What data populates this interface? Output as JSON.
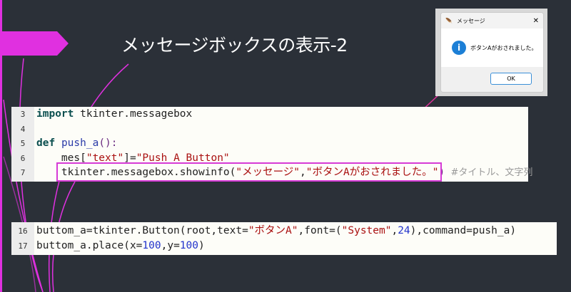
{
  "slide": {
    "title": "メッセージボックスの表示-2"
  },
  "colors": {
    "accent": "#e030e0",
    "background": "#2b3038"
  },
  "dialog": {
    "title": "メッセージ",
    "message": "ボタンAがおされました。",
    "ok_label": "OK",
    "icon": "info-icon",
    "close": "✕",
    "app_icon": "feather-icon"
  },
  "code_block_1": [
    {
      "num": "3",
      "tokens": [
        {
          "t": "import",
          "c": "kw"
        },
        {
          "t": " tkinter.messagebox",
          "c": ""
        }
      ]
    },
    {
      "num": "4",
      "tokens": []
    },
    {
      "num": "5",
      "tokens": [
        {
          "t": "def",
          "c": "kw"
        },
        {
          "t": " ",
          "c": ""
        },
        {
          "t": "push_a",
          "c": "fn"
        },
        {
          "t": "():",
          "c": "par"
        }
      ]
    },
    {
      "num": "6",
      "tokens": [
        {
          "t": "    mes[",
          "c": ""
        },
        {
          "t": "\"text\"",
          "c": "str"
        },
        {
          "t": "]=",
          "c": ""
        },
        {
          "t": "\"Push A Button\"",
          "c": "str"
        }
      ]
    },
    {
      "num": "7",
      "tokens": [
        {
          "t": "    tkinter.messagebox.showinfo(",
          "c": ""
        },
        {
          "t": "\"メッセージ\"",
          "c": "str"
        },
        {
          "t": ",",
          "c": ""
        },
        {
          "t": "\"ボタンAがおされました。\"",
          "c": "str"
        },
        {
          "t": ")",
          "c": "par"
        },
        {
          "t": "  #タイトル、文字列",
          "c": "cm"
        }
      ]
    }
  ],
  "code_block_2": [
    {
      "num": "16",
      "tokens": [
        {
          "t": "buttom_a=tkinter.Button(root,text=",
          "c": ""
        },
        {
          "t": "\"ボタンA\"",
          "c": "str"
        },
        {
          "t": ",font=(",
          "c": ""
        },
        {
          "t": "\"System\"",
          "c": "str"
        },
        {
          "t": ",",
          "c": ""
        },
        {
          "t": "24",
          "c": "numv"
        },
        {
          "t": "),command=push_a)",
          "c": ""
        }
      ]
    },
    {
      "num": "17",
      "tokens": [
        {
          "t": "buttom_a.place(x=",
          "c": ""
        },
        {
          "t": "100",
          "c": "numv"
        },
        {
          "t": ",y=",
          "c": ""
        },
        {
          "t": "100",
          "c": "numv"
        },
        {
          "t": ")",
          "c": ""
        }
      ]
    }
  ]
}
